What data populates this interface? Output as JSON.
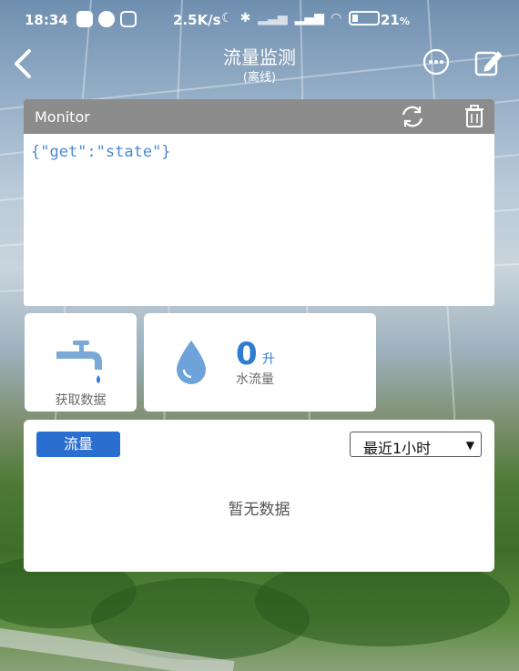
{
  "status_bar": {
    "time": "18:34",
    "net_speed": "2.5K/s",
    "battery_percent": "21",
    "battery_unit": "%"
  },
  "nav": {
    "title": "流量监测",
    "subtitle": "(离线)"
  },
  "monitor": {
    "header": "Monitor",
    "log_text": "{\"get\":\"state\"}"
  },
  "fetch_card": {
    "label": "获取数据"
  },
  "flow_card": {
    "value": "0",
    "unit": "升",
    "label": "水流量"
  },
  "chart_card": {
    "tab_label": "流量",
    "range_selected": "最近1小时",
    "empty_text": "暂无数据"
  },
  "colors": {
    "accent": "#2a6fd0",
    "value_blue": "#2e7bd1",
    "monitor_header": "#8c8c8c"
  }
}
